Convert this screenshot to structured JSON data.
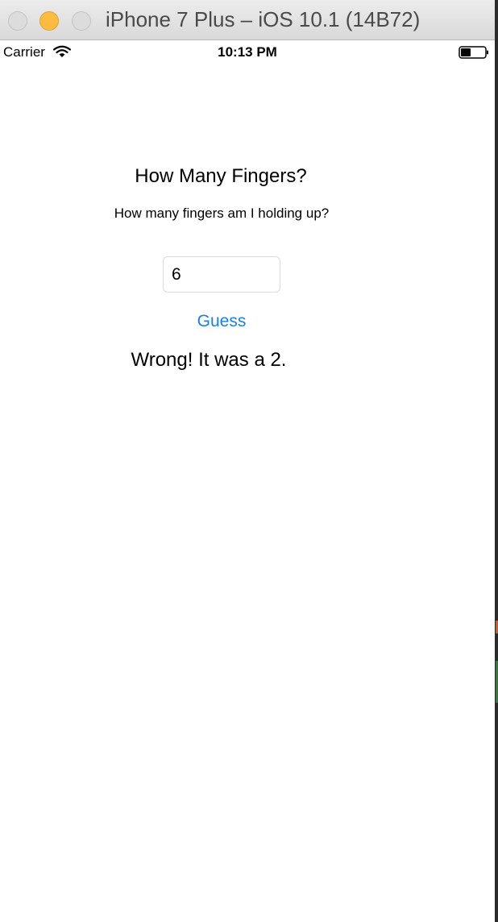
{
  "window": {
    "title": "iPhone 7 Plus – iOS 10.1 (14B72)"
  },
  "status_bar": {
    "carrier": "Carrier",
    "time": "10:13 PM",
    "icons": [
      "wifi-icon",
      "battery-icon"
    ]
  },
  "app": {
    "title": "How Many Fingers?",
    "subtitle": "How many fingers am I holding up?",
    "guess_field": {
      "value": "6",
      "placeholder": ""
    },
    "guess_button_label": "Guess",
    "result_text": "Wrong! It was a 2."
  },
  "colors": {
    "accent": "#1a7fe8",
    "minimize": "#fdbc40"
  }
}
